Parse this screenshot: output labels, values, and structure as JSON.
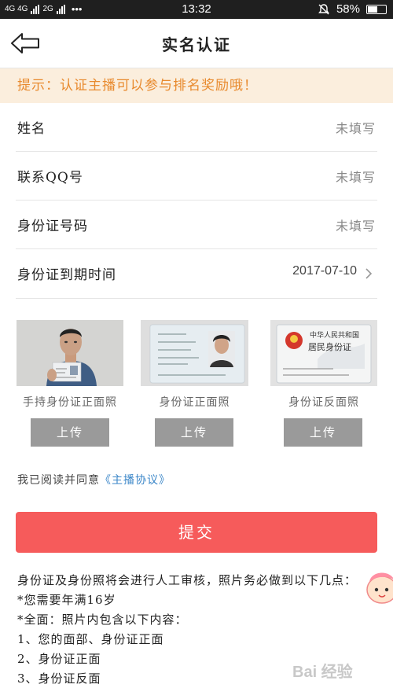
{
  "status_bar": {
    "network": "4G 4G",
    "network2": "2G",
    "dots": "•••",
    "time": "13:32",
    "battery": "58%",
    "battery_level": 0.58
  },
  "header": {
    "title": "实名认证"
  },
  "tip": {
    "text": "提示：认证主播可以参与排名奖励哦！"
  },
  "form": {
    "rows": [
      {
        "label": "姓名",
        "value": "未填写"
      },
      {
        "label": "联系QQ号",
        "value": "未填写"
      },
      {
        "label": "身份证号码",
        "value": "未填写"
      },
      {
        "label": "身份证到期时间",
        "value": "2017-07-10"
      }
    ]
  },
  "uploads": [
    {
      "caption": "手持身份证正面照",
      "button": "上传"
    },
    {
      "caption": "身份证正面照",
      "button": "上传"
    },
    {
      "caption": "身份证反面照",
      "button": "上传"
    }
  ],
  "id_card_back": {
    "line1": "中华人民共和国",
    "line2": "居民身份证"
  },
  "agreement": {
    "prefix": "我已阅读并同意",
    "link": "《主播协议》"
  },
  "submit": {
    "label": "提交"
  },
  "notes": [
    "身份证及身份照将会进行人工审核，照片务必做到以下几点：",
    "*您需要年满16岁",
    "*全面：照片内包含以下内容：",
    "1、您的面部、身份证正面",
    "2、身份证正面",
    "3、身份证反面"
  ],
  "watermark": "Bai 经验",
  "colors": {
    "accent": "#f65b5b",
    "tip_bg": "#fbeedd",
    "tip_text": "#e88a2e",
    "link": "#3a86c8",
    "upload_btn": "#9a9a9a"
  }
}
